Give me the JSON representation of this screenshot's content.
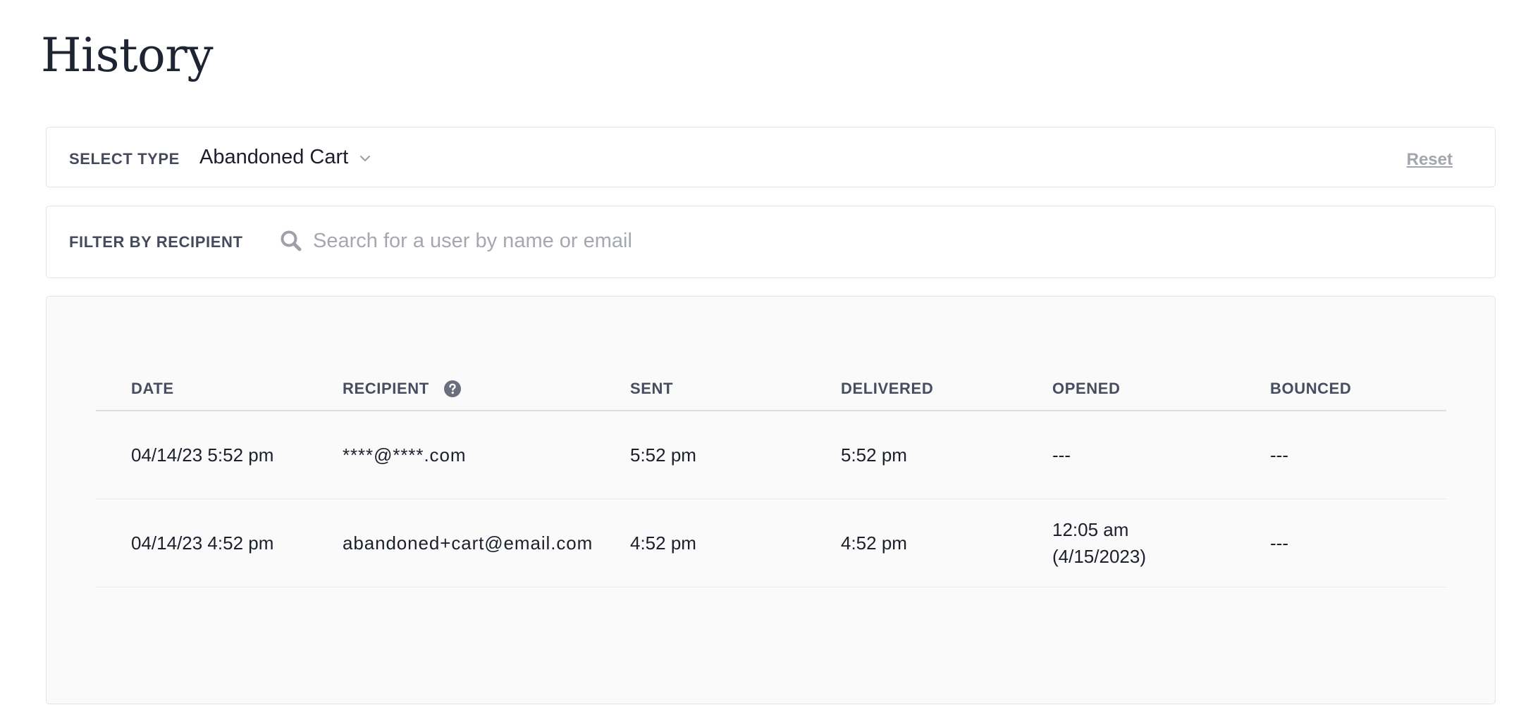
{
  "page": {
    "title": "History"
  },
  "type_filter": {
    "label": "SELECT TYPE",
    "selected": "Abandoned Cart",
    "reset_label": "Reset"
  },
  "recipient_filter": {
    "label": "FILTER BY RECIPIENT",
    "placeholder": "Search for a user by name or email",
    "value": ""
  },
  "table": {
    "headers": {
      "date": "DATE",
      "recipient": "RECIPIENT",
      "sent": "SENT",
      "delivered": "DELIVERED",
      "opened": "OPENED",
      "bounced": "BOUNCED"
    },
    "rows": [
      {
        "date": "04/14/23 5:52 pm",
        "recipient": "****@****.com",
        "sent": "5:52 pm",
        "delivered": "5:52 pm",
        "opened": "---",
        "bounced": "---"
      },
      {
        "date": "04/14/23 4:52 pm",
        "recipient": "abandoned+cart@email.com",
        "sent": "4:52 pm",
        "delivered": "4:52 pm",
        "opened": "12:05 am (4/15/2023)",
        "bounced": "---"
      }
    ]
  },
  "icons": {
    "search": "search-icon",
    "help": "question-circle-icon",
    "dropdown": "chevron-down-icon"
  }
}
